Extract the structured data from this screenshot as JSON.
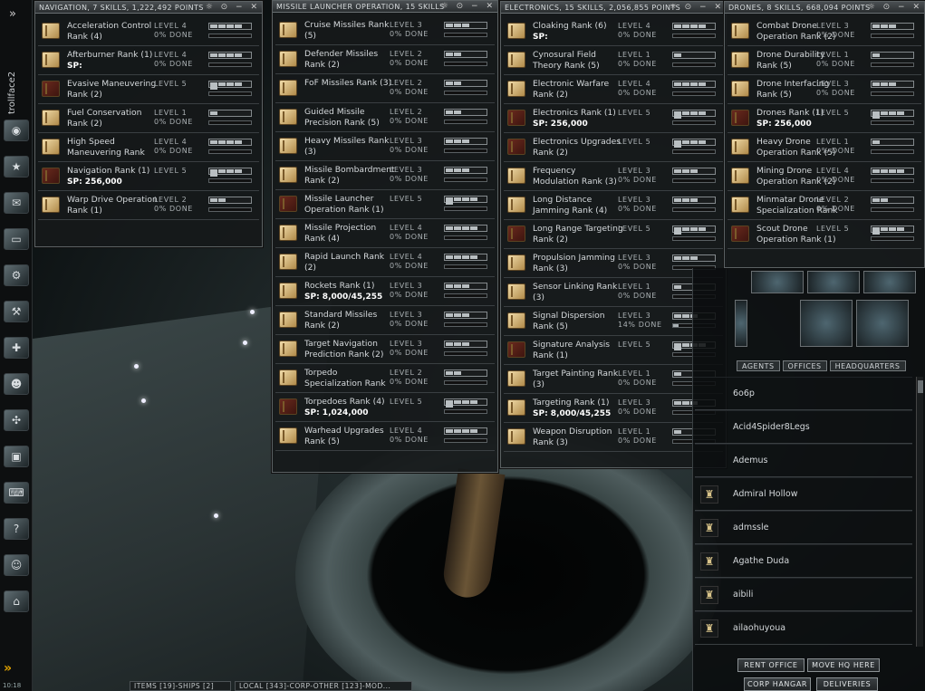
{
  "sidebar": {
    "character": "trollface2",
    "clock": "10:18",
    "icons": [
      "eye-icon",
      "star-icon",
      "mail-icon",
      "notepad-icon",
      "market-icon",
      "fitting-icon",
      "map-icon",
      "people-icon",
      "skills-icon",
      "cargo-icon",
      "calculator-icon",
      "help-icon",
      "agent-icon",
      "station-icon"
    ]
  },
  "panels": [
    {
      "id": "navigation",
      "title": "NAVIGATION, 7 SKILLS, 1,222,492 POINTS",
      "skills": [
        {
          "name": "Acceleration Control Rank (4)",
          "level": "LEVEL 4",
          "done": "0% DONE",
          "lvl": 4,
          "progress": 0
        },
        {
          "name": "Afterburner Rank (1)",
          "sp": "SP:",
          "level": "LEVEL 4",
          "done": "0% DONE",
          "lvl": 4,
          "progress": 0
        },
        {
          "name": "Evasive Maneuvering Rank (2)",
          "level": "LEVEL 5",
          "done": "",
          "lvl": 5,
          "progress": 0
        },
        {
          "name": "Fuel Conservation Rank (2)",
          "level": "LEVEL 1",
          "done": "0% DONE",
          "lvl": 1,
          "progress": 0
        },
        {
          "name": "High Speed Maneuvering Rank",
          "level": "LEVEL 4",
          "done": "0% DONE",
          "lvl": 4,
          "progress": 0
        },
        {
          "name": "Navigation Rank (1)",
          "sp": "SP:  256,000",
          "level": "LEVEL 5",
          "done": "",
          "lvl": 5,
          "progress": 0
        },
        {
          "name": "Warp Drive Operation Rank (1)",
          "level": "LEVEL 2",
          "done": "0% DONE",
          "lvl": 2,
          "progress": 0
        }
      ]
    },
    {
      "id": "missile",
      "title": "MISSILE LAUNCHER OPERATION, 15 SKILLS",
      "skills": [
        {
          "name": "Cruise Missiles Rank (5)",
          "level": "LEVEL 3",
          "done": "0% DONE",
          "lvl": 3,
          "progress": 0
        },
        {
          "name": "Defender Missiles Rank (2)",
          "level": "LEVEL 2",
          "done": "0% DONE",
          "lvl": 2,
          "progress": 0
        },
        {
          "name": "FoF Missiles Rank (3)",
          "level": "LEVEL 2",
          "done": "0% DONE",
          "lvl": 2,
          "progress": 0
        },
        {
          "name": "Guided Missile Precision Rank (5)",
          "level": "LEVEL 2",
          "done": "0% DONE",
          "lvl": 2,
          "progress": 0
        },
        {
          "name": "Heavy Missiles Rank (3)",
          "level": "LEVEL 3",
          "done": "0% DONE",
          "lvl": 3,
          "progress": 0
        },
        {
          "name": "Missile Bombardment Rank (2)",
          "level": "LEVEL 3",
          "done": "0% DONE",
          "lvl": 3,
          "progress": 0
        },
        {
          "name": "Missile Launcher Operation Rank (1)",
          "level": "LEVEL 5",
          "done": "",
          "lvl": 5,
          "progress": 0
        },
        {
          "name": "Missile Projection Rank (4)",
          "level": "LEVEL 4",
          "done": "0% DONE",
          "lvl": 4,
          "progress": 0
        },
        {
          "name": "Rapid Launch Rank (2)",
          "level": "LEVEL 4",
          "done": "0% DONE",
          "lvl": 4,
          "progress": 0
        },
        {
          "name": "Rockets Rank (1)",
          "sp": "SP:  8,000/45,255",
          "level": "LEVEL 3",
          "done": "0% DONE",
          "lvl": 3,
          "progress": 0
        },
        {
          "name": "Standard Missiles Rank (2)",
          "level": "LEVEL 3",
          "done": "0% DONE",
          "lvl": 3,
          "progress": 0
        },
        {
          "name": "Target Navigation Prediction Rank (2)",
          "level": "LEVEL 3",
          "done": "0% DONE",
          "lvl": 3,
          "progress": 0
        },
        {
          "name": "Torpedo Specialization Rank",
          "level": "LEVEL 2",
          "done": "0% DONE",
          "lvl": 2,
          "progress": 0
        },
        {
          "name": "Torpedoes Rank (4)",
          "sp": "SP:  1,024,000",
          "level": "LEVEL 5",
          "done": "",
          "lvl": 5,
          "progress": 0
        },
        {
          "name": "Warhead Upgrades Rank (5)",
          "level": "LEVEL 4",
          "done": "0% DONE",
          "lvl": 4,
          "progress": 0
        }
      ]
    },
    {
      "id": "electronics",
      "title": "ELECTRONICS, 15 SKILLS, 2,056,855 POINTS",
      "skills": [
        {
          "name": "Cloaking Rank (6)",
          "sp": "SP:",
          "level": "LEVEL 4",
          "done": "0% DONE",
          "lvl": 4,
          "progress": 0
        },
        {
          "name": "Cynosural Field Theory Rank (5)",
          "level": "LEVEL 1",
          "done": "0% DONE",
          "lvl": 1,
          "progress": 0
        },
        {
          "name": "Electronic Warfare Rank (2)",
          "level": "LEVEL 4",
          "done": "0% DONE",
          "lvl": 4,
          "progress": 0
        },
        {
          "name": "Electronics Rank (1)",
          "sp": "SP:  256,000",
          "level": "LEVEL 5",
          "done": "",
          "lvl": 5,
          "progress": 0
        },
        {
          "name": "Electronics Upgrades Rank (2)",
          "level": "LEVEL 5",
          "done": "",
          "lvl": 5,
          "progress": 0
        },
        {
          "name": "Frequency Modulation Rank (3)",
          "level": "LEVEL 3",
          "done": "0% DONE",
          "lvl": 3,
          "progress": 0
        },
        {
          "name": "Long Distance Jamming Rank (4)",
          "level": "LEVEL 3",
          "done": "0% DONE",
          "lvl": 3,
          "progress": 0
        },
        {
          "name": "Long Range Targeting Rank (2)",
          "level": "LEVEL 5",
          "done": "",
          "lvl": 5,
          "progress": 0
        },
        {
          "name": "Propulsion Jamming Rank (3)",
          "level": "LEVEL 3",
          "done": "0% DONE",
          "lvl": 3,
          "progress": 0
        },
        {
          "name": "Sensor Linking Rank (3)",
          "level": "LEVEL 1",
          "done": "0% DONE",
          "lvl": 1,
          "progress": 0
        },
        {
          "name": "Signal Dispersion Rank (5)",
          "level": "LEVEL 3",
          "done": "14% DONE",
          "lvl": 3,
          "progress": 0.14
        },
        {
          "name": "Signature Analysis Rank (1)",
          "level": "LEVEL 5",
          "done": "",
          "lvl": 5,
          "progress": 0
        },
        {
          "name": "Target Painting Rank (3)",
          "level": "LEVEL 1",
          "done": "0% DONE",
          "lvl": 1,
          "progress": 0
        },
        {
          "name": "Targeting Rank (1)",
          "sp": "SP:  8,000/45,255",
          "level": "LEVEL 3",
          "done": "0% DONE",
          "lvl": 3,
          "progress": 0
        },
        {
          "name": "Weapon Disruption Rank (3)",
          "level": "LEVEL 1",
          "done": "0% DONE",
          "lvl": 1,
          "progress": 0
        }
      ]
    },
    {
      "id": "drones",
      "title": "DRONES, 8 SKILLS, 668,094 POINTS",
      "skills": [
        {
          "name": "Combat Drone Operation Rank (2)",
          "level": "LEVEL 3",
          "done": "0% DONE",
          "lvl": 3,
          "progress": 0
        },
        {
          "name": "Drone Durability Rank (5)",
          "level": "LEVEL 1",
          "done": "0% DONE",
          "lvl": 1,
          "progress": 0
        },
        {
          "name": "Drone Interfacing Rank (5)",
          "level": "LEVEL 3",
          "done": "0% DONE",
          "lvl": 3,
          "progress": 0
        },
        {
          "name": "Drones Rank (1)",
          "sp": "SP:  256,000",
          "level": "LEVEL 5",
          "done": "",
          "lvl": 5,
          "progress": 0
        },
        {
          "name": "Heavy Drone Operation Rank (5)",
          "level": "LEVEL 1",
          "done": "0% DONE",
          "lvl": 1,
          "progress": 0
        },
        {
          "name": "Mining Drone Operation Rank (2)",
          "level": "LEVEL 4",
          "done": "0% DONE",
          "lvl": 4,
          "progress": 0
        },
        {
          "name": "Minmatar Drone Specialization Rank",
          "level": "LEVEL 2",
          "done": "0% DONE",
          "lvl": 2,
          "progress": 0
        },
        {
          "name": "Scout Drone Operation Rank (1)",
          "level": "LEVEL 5",
          "done": "",
          "lvl": 5,
          "progress": 0
        }
      ]
    }
  ],
  "window_controls": "☼ ⊙ − ✕",
  "corp": {
    "tabs": [
      "AGENTS",
      "OFFICES",
      "HEADQUARTERS"
    ],
    "agents": [
      "6o6p",
      "Acid4Spider8Legs",
      "Ademus",
      "Admiral Hollow",
      "admssle",
      "Agathe Duda",
      "aibili",
      "ailaohuyoua"
    ],
    "buttons": {
      "rent_office": "RENT OFFICE",
      "move_hq": "MOVE HQ HERE",
      "corp_hangar": "CORP HANGAR",
      "deliveries": "DELIVERIES"
    }
  },
  "bottom": {
    "items": "ITEMS [19]-SHIPS [2]",
    "local": "LOCAL [343]-CORP-OTHER [123]-MOD..."
  }
}
